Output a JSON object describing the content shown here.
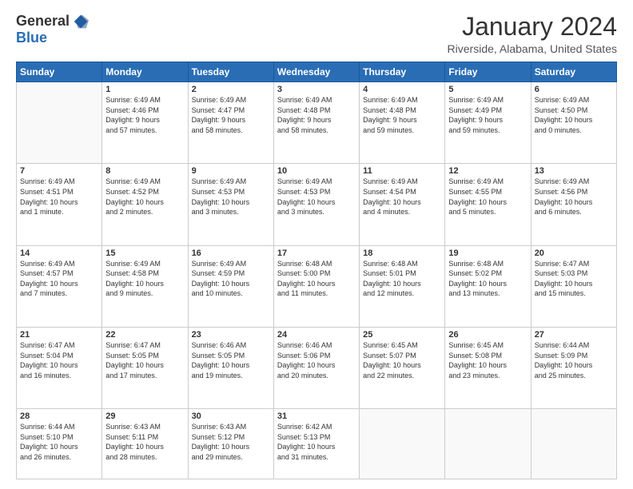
{
  "logo": {
    "general": "General",
    "blue": "Blue"
  },
  "title": "January 2024",
  "subtitle": "Riverside, Alabama, United States",
  "days_of_week": [
    "Sunday",
    "Monday",
    "Tuesday",
    "Wednesday",
    "Thursday",
    "Friday",
    "Saturday"
  ],
  "weeks": [
    [
      {
        "day": "",
        "info": ""
      },
      {
        "day": "1",
        "info": "Sunrise: 6:49 AM\nSunset: 4:46 PM\nDaylight: 9 hours\nand 57 minutes."
      },
      {
        "day": "2",
        "info": "Sunrise: 6:49 AM\nSunset: 4:47 PM\nDaylight: 9 hours\nand 58 minutes."
      },
      {
        "day": "3",
        "info": "Sunrise: 6:49 AM\nSunset: 4:48 PM\nDaylight: 9 hours\nand 58 minutes."
      },
      {
        "day": "4",
        "info": "Sunrise: 6:49 AM\nSunset: 4:48 PM\nDaylight: 9 hours\nand 59 minutes."
      },
      {
        "day": "5",
        "info": "Sunrise: 6:49 AM\nSunset: 4:49 PM\nDaylight: 9 hours\nand 59 minutes."
      },
      {
        "day": "6",
        "info": "Sunrise: 6:49 AM\nSunset: 4:50 PM\nDaylight: 10 hours\nand 0 minutes."
      }
    ],
    [
      {
        "day": "7",
        "info": "Sunrise: 6:49 AM\nSunset: 4:51 PM\nDaylight: 10 hours\nand 1 minute."
      },
      {
        "day": "8",
        "info": "Sunrise: 6:49 AM\nSunset: 4:52 PM\nDaylight: 10 hours\nand 2 minutes."
      },
      {
        "day": "9",
        "info": "Sunrise: 6:49 AM\nSunset: 4:53 PM\nDaylight: 10 hours\nand 3 minutes."
      },
      {
        "day": "10",
        "info": "Sunrise: 6:49 AM\nSunset: 4:53 PM\nDaylight: 10 hours\nand 3 minutes."
      },
      {
        "day": "11",
        "info": "Sunrise: 6:49 AM\nSunset: 4:54 PM\nDaylight: 10 hours\nand 4 minutes."
      },
      {
        "day": "12",
        "info": "Sunrise: 6:49 AM\nSunset: 4:55 PM\nDaylight: 10 hours\nand 5 minutes."
      },
      {
        "day": "13",
        "info": "Sunrise: 6:49 AM\nSunset: 4:56 PM\nDaylight: 10 hours\nand 6 minutes."
      }
    ],
    [
      {
        "day": "14",
        "info": "Sunrise: 6:49 AM\nSunset: 4:57 PM\nDaylight: 10 hours\nand 7 minutes."
      },
      {
        "day": "15",
        "info": "Sunrise: 6:49 AM\nSunset: 4:58 PM\nDaylight: 10 hours\nand 9 minutes."
      },
      {
        "day": "16",
        "info": "Sunrise: 6:49 AM\nSunset: 4:59 PM\nDaylight: 10 hours\nand 10 minutes."
      },
      {
        "day": "17",
        "info": "Sunrise: 6:48 AM\nSunset: 5:00 PM\nDaylight: 10 hours\nand 11 minutes."
      },
      {
        "day": "18",
        "info": "Sunrise: 6:48 AM\nSunset: 5:01 PM\nDaylight: 10 hours\nand 12 minutes."
      },
      {
        "day": "19",
        "info": "Sunrise: 6:48 AM\nSunset: 5:02 PM\nDaylight: 10 hours\nand 13 minutes."
      },
      {
        "day": "20",
        "info": "Sunrise: 6:47 AM\nSunset: 5:03 PM\nDaylight: 10 hours\nand 15 minutes."
      }
    ],
    [
      {
        "day": "21",
        "info": "Sunrise: 6:47 AM\nSunset: 5:04 PM\nDaylight: 10 hours\nand 16 minutes."
      },
      {
        "day": "22",
        "info": "Sunrise: 6:47 AM\nSunset: 5:05 PM\nDaylight: 10 hours\nand 17 minutes."
      },
      {
        "day": "23",
        "info": "Sunrise: 6:46 AM\nSunset: 5:05 PM\nDaylight: 10 hours\nand 19 minutes."
      },
      {
        "day": "24",
        "info": "Sunrise: 6:46 AM\nSunset: 5:06 PM\nDaylight: 10 hours\nand 20 minutes."
      },
      {
        "day": "25",
        "info": "Sunrise: 6:45 AM\nSunset: 5:07 PM\nDaylight: 10 hours\nand 22 minutes."
      },
      {
        "day": "26",
        "info": "Sunrise: 6:45 AM\nSunset: 5:08 PM\nDaylight: 10 hours\nand 23 minutes."
      },
      {
        "day": "27",
        "info": "Sunrise: 6:44 AM\nSunset: 5:09 PM\nDaylight: 10 hours\nand 25 minutes."
      }
    ],
    [
      {
        "day": "28",
        "info": "Sunrise: 6:44 AM\nSunset: 5:10 PM\nDaylight: 10 hours\nand 26 minutes."
      },
      {
        "day": "29",
        "info": "Sunrise: 6:43 AM\nSunset: 5:11 PM\nDaylight: 10 hours\nand 28 minutes."
      },
      {
        "day": "30",
        "info": "Sunrise: 6:43 AM\nSunset: 5:12 PM\nDaylight: 10 hours\nand 29 minutes."
      },
      {
        "day": "31",
        "info": "Sunrise: 6:42 AM\nSunset: 5:13 PM\nDaylight: 10 hours\nand 31 minutes."
      },
      {
        "day": "",
        "info": ""
      },
      {
        "day": "",
        "info": ""
      },
      {
        "day": "",
        "info": ""
      }
    ]
  ]
}
